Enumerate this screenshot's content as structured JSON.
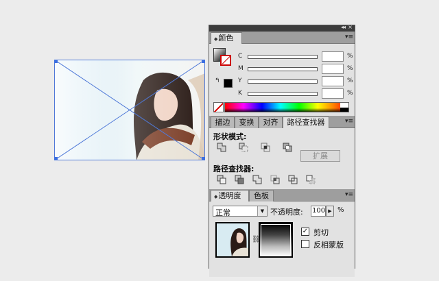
{
  "colors": {
    "accent_selection": "#4f79d8",
    "panel_bg": "#e2e2e2",
    "tab_bar": "#9e9e9e",
    "stroke_red": "#cc0000"
  },
  "placed_image": {
    "subject": "photo-of-woman-with-scarf",
    "selected": true
  },
  "panels": {
    "color": {
      "tab_label": "颜色",
      "tab_icon": "double-arrow-icon",
      "channels": [
        {
          "letter": "C",
          "value": "",
          "unit": "%"
        },
        {
          "letter": "M",
          "value": "",
          "unit": "%"
        },
        {
          "letter": "Y",
          "value": "",
          "unit": "%"
        },
        {
          "letter": "K",
          "value": "",
          "unit": "%"
        }
      ]
    },
    "pathfinder_group": {
      "tabs": [
        {
          "label": "描边",
          "active": false
        },
        {
          "label": "变换",
          "active": false
        },
        {
          "label": "对齐",
          "active": false
        },
        {
          "label": "路径查找器",
          "active": true
        }
      ],
      "shape_modes_label": "形状模式:",
      "shape_mode_buttons": [
        "unite-icon",
        "minus-front-icon",
        "intersect-icon",
        "exclude-icon"
      ],
      "expand_label": "扩展",
      "pathfinders_label": "路径查找器:",
      "pathfinder_buttons": [
        "divide-icon",
        "trim-icon",
        "merge-icon",
        "crop-icon",
        "outline-icon",
        "minus-back-icon"
      ]
    },
    "transparency_group": {
      "tabs": [
        {
          "label": "透明度",
          "active": true
        },
        {
          "label": "色板",
          "active": false
        }
      ],
      "blend_mode": "正常",
      "opacity_label": "不透明度:",
      "opacity_value": "100",
      "opacity_unit": "%",
      "clip_label": "剪切",
      "clip_checked": true,
      "clip_mark": "✓",
      "invert_label": "反相蒙版",
      "invert_checked": false
    }
  },
  "window": {
    "collapse_glyph": "◂◂",
    "close_glyph": "×",
    "menu_glyph": "▾≡"
  }
}
